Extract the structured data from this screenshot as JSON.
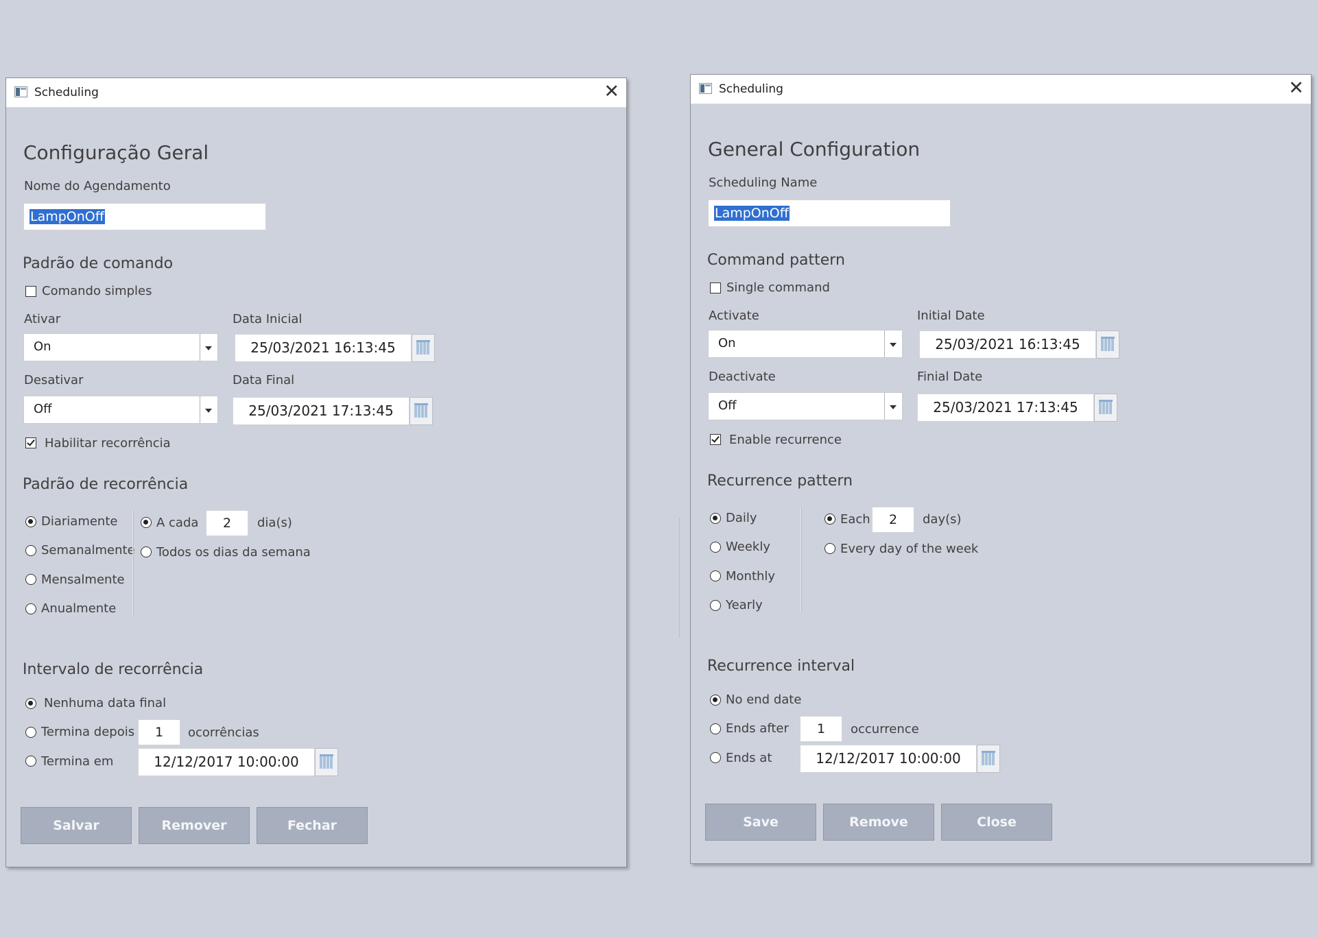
{
  "windows": [
    {
      "title": "Scheduling",
      "header": "Configuração Geral",
      "name_label": "Nome do Agendamento",
      "name_value": "LampOnOff",
      "command_section": "Padrão de comando",
      "single_command": "Comando simples",
      "single_command_checked": false,
      "activate_label": "Ativar",
      "activate_value": "On",
      "initial_date_label": "Data Inicial",
      "initial_date_value": "25/03/2021 16:13:45",
      "deactivate_label": "Desativar",
      "deactivate_value": "Off",
      "final_date_label": "Data Final",
      "final_date_value": "25/03/2021 17:13:45",
      "enable_recurrence": "Habilitar recorrência",
      "enable_recurrence_checked": true,
      "recurrence_section": "Padrão de recorrência",
      "frequency_options": [
        "Diariamente",
        "Semanalmente",
        "Mensalmente",
        "Anualmente"
      ],
      "frequency_selected": "Diariamente",
      "each_label": "A cada",
      "each_value": "2",
      "days_unit": "dia(s)",
      "every_weekday": "Todos os dias da semana",
      "interval_section": "Intervalo de recorrência",
      "no_end_date": "Nenhuma data final",
      "ends_after": "Termina depois",
      "ends_after_value": "1",
      "occurrences_unit": "ocorrências",
      "ends_at": "Termina em",
      "ends_at_value": "12/12/2017 10:00:00",
      "buttons": {
        "save": "Salvar",
        "remove": "Remover",
        "close": "Fechar"
      }
    },
    {
      "title": "Scheduling",
      "header": "General Configuration",
      "name_label": "Scheduling Name",
      "name_value": "LampOnOff",
      "command_section": "Command pattern",
      "single_command": "Single command",
      "single_command_checked": false,
      "activate_label": "Activate",
      "activate_value": "On",
      "initial_date_label": "Initial Date",
      "initial_date_value": "25/03/2021 16:13:45",
      "deactivate_label": "Deactivate",
      "deactivate_value": "Off",
      "final_date_label": "Finial Date",
      "final_date_value": "25/03/2021 17:13:45",
      "enable_recurrence": "Enable recurrence",
      "enable_recurrence_checked": true,
      "recurrence_section": "Recurrence pattern",
      "frequency_options": [
        "Daily",
        "Weekly",
        "Monthly",
        "Yearly"
      ],
      "frequency_selected": "Daily",
      "each_label": "Each",
      "each_value": "2",
      "days_unit": "day(s)",
      "every_weekday": "Every day of the week",
      "interval_section": "Recurrence interval",
      "no_end_date": "No end date",
      "ends_after": "Ends after",
      "ends_after_value": "1",
      "occurrences_unit": "occurrence",
      "ends_at": "Ends at",
      "ends_at_value": "12/12/2017 10:00:00",
      "buttons": {
        "save": "Save",
        "remove": "Remove",
        "close": "Close"
      }
    }
  ]
}
